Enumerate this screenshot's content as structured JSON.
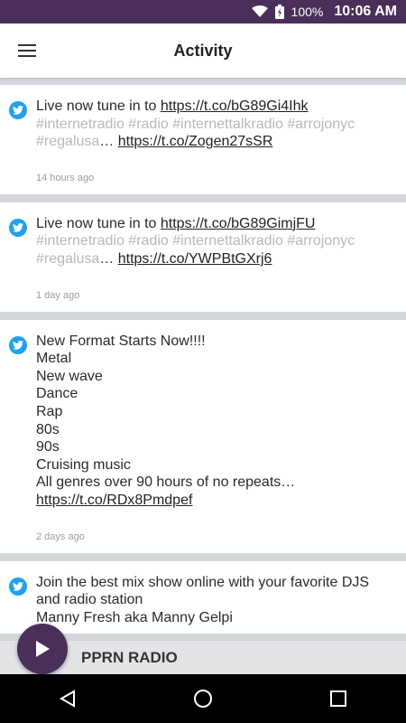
{
  "status_bar": {
    "battery_percent": "100%",
    "time": "10:06 AM",
    "icons": [
      "wifi-icon",
      "battery-icon"
    ]
  },
  "app_bar": {
    "title": "Activity",
    "menu_icon": "hamburger-menu-icon"
  },
  "feed": [
    {
      "text_before_link": "Live now tune in to ",
      "link1": "https://t.co/bG89Gi4Ihk",
      "hashtags": "#internetradio #radio #internettalkradio #arrojonyc #regalusa",
      "ellipsis": "… ",
      "link2": "https://t.co/Zogen27sSR",
      "time": "14 hours ago"
    },
    {
      "text_before_link": "Live now tune in to ",
      "link1": "https://t.co/bG89GimjFU",
      "hashtags": "#internetradio #radio #internettalkradio #arrojonyc #regalusa",
      "ellipsis": "… ",
      "link2": "https://t.co/YWPBtGXrj6",
      "time": "1 day ago"
    },
    {
      "lines": [
        "New Format Starts Now!!!!",
        "Metal",
        "New wave",
        "Dance",
        "Rap",
        "80s",
        "90s",
        "Cruising music"
      ],
      "last_line": "All genres over 90 hours of no repeats… ",
      "link": "https://t.co/RDx8Pmdpef",
      "time": "2 days ago"
    },
    {
      "lines": [
        "Join the best mix show online with your favorite DJS and radio station",
        "Manny Fresh aka Manny Gelpi"
      ]
    }
  ],
  "player": {
    "station": "PPRN RADIO",
    "play_icon": "play-icon"
  },
  "nav": {
    "back_icon": "back-triangle-icon",
    "home_icon": "home-circle-icon",
    "recents_icon": "recents-square-icon"
  },
  "colors": {
    "accent": "#4a2f5b",
    "twitter": "#1da1f2",
    "hashtag": "#b5b8bd"
  }
}
